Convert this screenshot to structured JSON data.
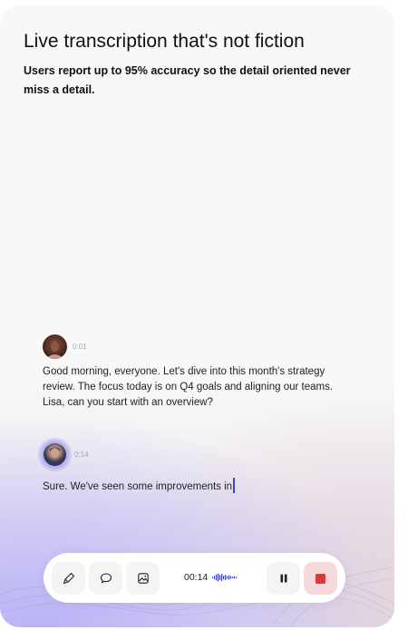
{
  "header": {
    "title": "Live transcription that's not fiction",
    "subtitle": "Users report up to 95% accuracy so the detail oriented never miss a detail."
  },
  "transcript": [
    {
      "time": "0:01",
      "text": "Good morning, everyone. Let's dive into this month's strategy review. The focus today is on Q4 goals and aligning our teams. Lisa, can you start with an overview?"
    },
    {
      "time": "0:14",
      "text": "Sure. We've seen some improvements in"
    }
  ],
  "toolbar": {
    "elapsed": "00:14",
    "icons": {
      "highlight": "highlighter-icon",
      "comment": "comment-bubble-icon",
      "image": "image-icon",
      "waveform": "waveform-icon",
      "pause": "pause-icon",
      "stop": "stop-icon"
    }
  },
  "colors": {
    "accent": "#3a46c8",
    "stop": "#d63a3a",
    "stop_bg": "#f6d9da",
    "avatar_ring": "#b9b4f0"
  }
}
